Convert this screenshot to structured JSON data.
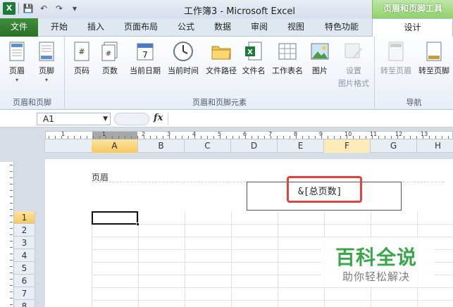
{
  "window": {
    "title": "工作簿3 - Microsoft Excel",
    "context_tab_group": "页眉和页脚工具"
  },
  "tabs": {
    "file": "文件",
    "items": [
      "开始",
      "插入",
      "页面布局",
      "公式",
      "数据",
      "审阅",
      "视图",
      "特色功能"
    ],
    "design": "设计"
  },
  "ribbon": {
    "groups": {
      "header_footer": "页眉和页脚",
      "elements": "页眉和页脚元素",
      "navigation": "导航"
    },
    "buttons": {
      "header": "页眉",
      "footer": "页脚",
      "page_number": "页码",
      "page_count": "页数",
      "current_date": "当前日期",
      "current_time": "当前时间",
      "file_path": "文件路径",
      "file_name": "文件名",
      "sheet_name": "工作表名",
      "picture": "图片",
      "format_picture_1": "设置",
      "format_picture_2": "图片格式",
      "goto_header": "转至页眉",
      "goto_footer": "转至页脚"
    }
  },
  "formula_bar": {
    "name_box": "A1",
    "fx": "fx",
    "value": ""
  },
  "sheet": {
    "columns": [
      "A",
      "B",
      "C",
      "D",
      "E",
      "F",
      "G",
      "H"
    ],
    "rows": [
      "1",
      "2",
      "3",
      "4",
      "5",
      "6",
      "7",
      "8"
    ],
    "ruler_numbers": [
      "1",
      "1",
      "2",
      "3",
      "4",
      "5",
      "6",
      "7",
      "8",
      "9",
      "10",
      "11",
      "12",
      "13"
    ],
    "header_label": "页眉",
    "header_center_code": "&[总页数]"
  },
  "watermark": {
    "title": "百科全说",
    "subtitle": "助你轻松解决"
  },
  "colors": {
    "file_tab": "#2b6f28",
    "context_tab": "#8fd16a",
    "selected_header": "#f6c95a",
    "highlight_box": "#e0443e",
    "watermark_green": "#3aa64a"
  }
}
